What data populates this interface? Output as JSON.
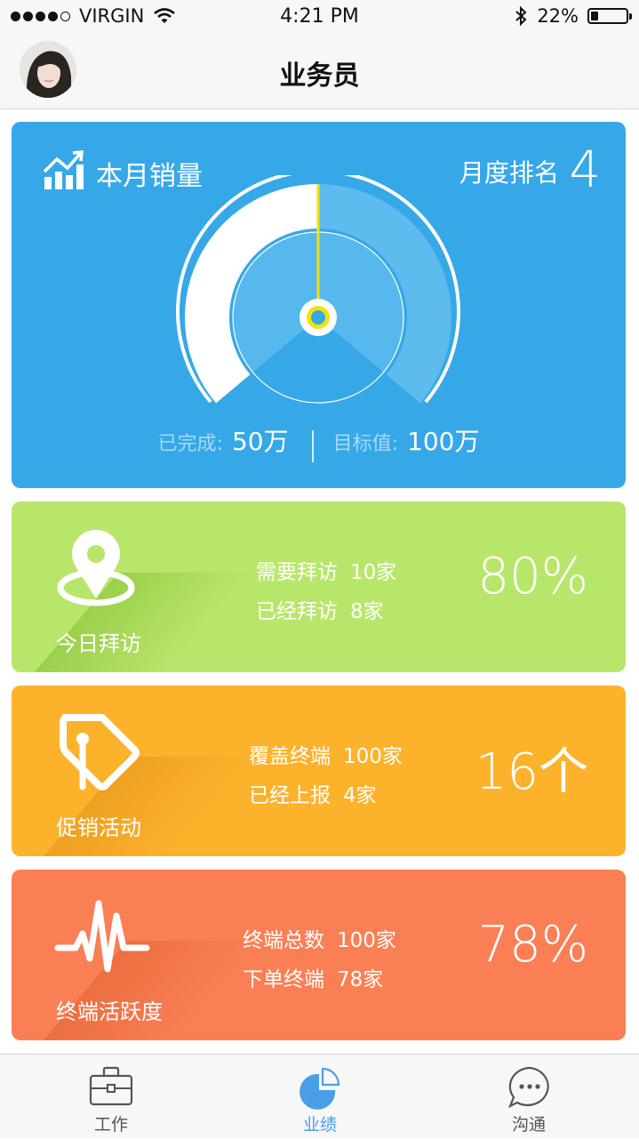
{
  "status_bar": {
    "carrier": "VIRGIN",
    "time": "4:21 PM",
    "battery_percent": "22%",
    "battery_level": 0.22,
    "icons": [
      "signal-dots",
      "wifi-icon",
      "bluetooth-icon",
      "battery-icon"
    ]
  },
  "nav": {
    "title": "业务员",
    "avatar_icon": "user-avatar"
  },
  "sales": {
    "title": "本月销量",
    "rank_label": "月度排名",
    "rank_value": "4",
    "completed_label": "已完成:",
    "completed_value": "50万",
    "target_label": "目标值:",
    "target_value": "100万",
    "progress_fraction": 0.5,
    "icon": "bar-chart-trend-icon"
  },
  "kpis": [
    {
      "name": "今日拜访",
      "icon": "location-pin-icon",
      "line1_label": "需要拜访",
      "line1_value": "10家",
      "line2_label": "已经拜访",
      "line2_value": "8家",
      "big_value": "80%",
      "color": "#b8e66a"
    },
    {
      "name": "促销活动",
      "icon": "price-tag-icon",
      "line1_label": "覆盖终端",
      "line1_value": "100家",
      "line2_label": "已经上报",
      "line2_value": "4家",
      "big_value": "16个",
      "color": "#fdb22c"
    },
    {
      "name": "终端活跃度",
      "icon": "pulse-wave-icon",
      "line1_label": "终端总数",
      "line1_value": "100家",
      "line2_label": "下单终端",
      "line2_value": "78家",
      "big_value": "78%",
      "color": "#fa7f55"
    }
  ],
  "tabs": [
    {
      "label": "工作",
      "icon": "briefcase-icon",
      "active": false
    },
    {
      "label": "业绩",
      "icon": "pie-chart-icon",
      "active": true
    },
    {
      "label": "沟通",
      "icon": "chat-bubble-icon",
      "active": false
    }
  ],
  "colors": {
    "sales_card": "#36a8e8",
    "tab_active": "#4a9ee6",
    "needle": "#f5e10a"
  }
}
